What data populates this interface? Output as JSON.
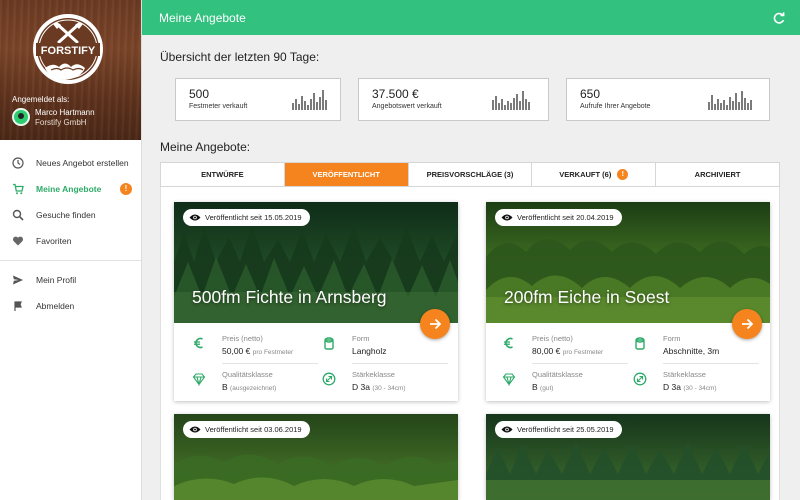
{
  "sidebar": {
    "brand": "FORSTIFY",
    "logged_in_label": "Angemeldet als:",
    "user_name": "Marco Hartmann",
    "user_company": "Forstify GmbH",
    "items": [
      {
        "label": "Neues Angebot erstellen",
        "icon": "clock-icon"
      },
      {
        "label": "Meine Angebote",
        "icon": "cart-icon",
        "active": true,
        "badge": "!"
      },
      {
        "label": "Gesuche finden",
        "icon": "search-icon"
      },
      {
        "label": "Favoriten",
        "icon": "heart-icon"
      },
      {
        "label": "Mein Profil",
        "icon": "send-icon"
      },
      {
        "label": "Abmelden",
        "icon": "flag-icon"
      }
    ]
  },
  "header": {
    "title": "Meine Angebote"
  },
  "overview": {
    "title": "Übersicht der letzten 90 Tage:",
    "stats": [
      {
        "value": "500",
        "label": "Festmeter verkauft"
      },
      {
        "value": "37.500 €",
        "label": "Angebotswert verkauft"
      },
      {
        "value": "650",
        "label": "Aufrufe Ihrer Angebote"
      }
    ]
  },
  "offers_title": "Meine Angebote:",
  "tabs": [
    {
      "label": "ENTWÜRFE"
    },
    {
      "label": "VERÖFFENTLICHT",
      "active": true
    },
    {
      "label": "PREISVORSCHLÄGE (3)"
    },
    {
      "label": "VERKAUFT (6)",
      "badge": "!"
    },
    {
      "label": "ARCHIVIERT"
    }
  ],
  "cards": [
    {
      "published": "Veröffentlicht seit 15.05.2019",
      "title": "500fm Fichte in Arnsberg",
      "price_label": "Preis (netto)",
      "price": "50,00 €",
      "price_unit": "pro Festmeter",
      "form_label": "Form",
      "form": "Langholz",
      "quality_label": "Qualitätsklasse",
      "quality": "B",
      "quality_note": "(ausgezeichnet)",
      "thickness_label": "Stärkeklasse",
      "thickness": "D 3a",
      "thickness_note": "(30 - 34cm)"
    },
    {
      "published": "Veröffentlicht seit 20.04.2019",
      "title": "200fm Eiche in Soest",
      "price_label": "Preis (netto)",
      "price": "80,00 €",
      "price_unit": "pro Festmeter",
      "form_label": "Form",
      "form": "Abschnitte, 3m",
      "quality_label": "Qualitätsklasse",
      "quality": "B",
      "quality_note": "(gut)",
      "thickness_label": "Stärkeklasse",
      "thickness": "D 3a",
      "thickness_note": "(30 - 34cm)"
    },
    {
      "published": "Veröffentlicht seit 03.06.2019"
    },
    {
      "published": "Veröffentlicht seit 25.05.2019"
    }
  ],
  "colors": {
    "accent_green": "#33c180",
    "accent_orange": "#f5841f"
  }
}
